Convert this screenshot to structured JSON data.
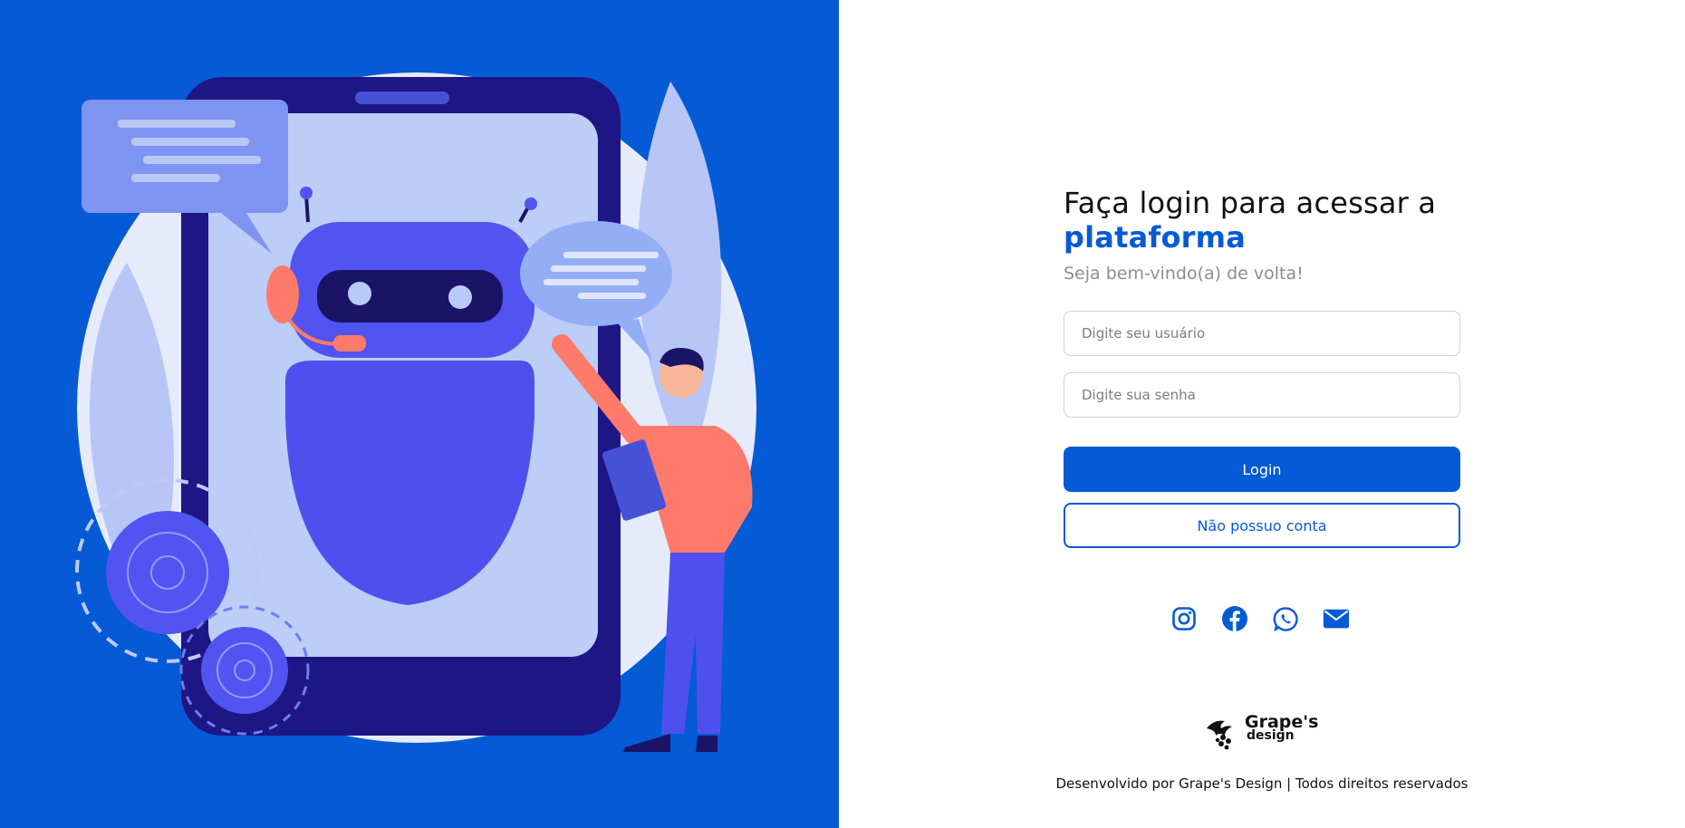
{
  "login": {
    "title": "Faça login para acessar a",
    "title_accent": "plataforma",
    "subtitle": "Seja bem-vindo(a) de volta!",
    "username_placeholder": "Digite seu usuário",
    "password_placeholder": "Digite sua senha",
    "login_label": "Login",
    "no_account_label": "Não possuo conta"
  },
  "socials": [
    {
      "icon": "instagram-icon"
    },
    {
      "icon": "facebook-icon"
    },
    {
      "icon": "whatsapp-icon"
    },
    {
      "icon": "mail-icon"
    }
  ],
  "brand": {
    "name": "Grape's",
    "sub": "design"
  },
  "footer": {
    "text": "Desenvolvido por Grape's Design | Todos direitos reservados"
  },
  "colors": {
    "primary": "#055ad6",
    "robot": "#5154f0",
    "accent": "#ff7a6b"
  }
}
